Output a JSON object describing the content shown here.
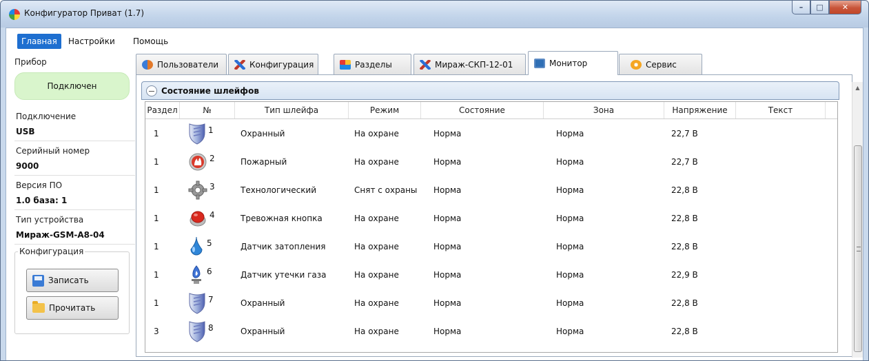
{
  "window": {
    "title": "Конфигуратор Приват (1.7)"
  },
  "menu": {
    "items": [
      "Главная",
      "Настройки",
      "Помощь"
    ]
  },
  "sidebar": {
    "device_group": "Прибор",
    "status": "Подключен",
    "connection_label": "Подключение",
    "connection_value": "USB",
    "serial_label": "Серийный номер",
    "serial_value": "9000",
    "firmware_label": "Версия ПО",
    "firmware_value": "1.0 база: 1",
    "device_type_label": "Тип устройства",
    "device_type_value": "Мираж-GSM-A8-04",
    "config_group": "Конфигурация",
    "write_button": "Записать",
    "read_button": "Прочитать"
  },
  "tabs": [
    "Пользователи",
    "Конфигурация",
    "Разделы",
    "Мираж-СКП-12-01",
    "Монитор",
    "Сервис"
  ],
  "active_tab": "Монитор",
  "section": {
    "title": "Состояние шлейфов"
  },
  "table": {
    "columns": [
      "Раздел",
      "№",
      "Тип шлейфа",
      "Режим",
      "Состояние",
      "Зона",
      "Напряжение",
      "Текст"
    ],
    "rows": [
      {
        "section": "1",
        "num": "1",
        "icon": "shield-icon",
        "type": "Охранный",
        "mode": "На охране",
        "state": "Норма",
        "zone": "Норма",
        "voltage": "22,7 В",
        "text": ""
      },
      {
        "section": "1",
        "num": "2",
        "icon": "fire-icon",
        "type": "Пожарный",
        "mode": "На охране",
        "state": "Норма",
        "zone": "Норма",
        "voltage": "22,7 В",
        "text": ""
      },
      {
        "section": "1",
        "num": "3",
        "icon": "gear-icon",
        "type": "Технологический",
        "mode": "Снят с охраны",
        "state": "Норма",
        "zone": "Норма",
        "voltage": "22,8 В",
        "text": ""
      },
      {
        "section": "1",
        "num": "4",
        "icon": "alarm-button-icon",
        "type": "Тревожная кнопка",
        "mode": "На охране",
        "state": "Норма",
        "zone": "Норма",
        "voltage": "22,8 В",
        "text": ""
      },
      {
        "section": "1",
        "num": "5",
        "icon": "water-drop-icon",
        "type": "Датчик затопления",
        "mode": "На охране",
        "state": "Норма",
        "zone": "Норма",
        "voltage": "22,8 В",
        "text": ""
      },
      {
        "section": "1",
        "num": "6",
        "icon": "gas-burner-icon",
        "type": "Датчик утечки газа",
        "mode": "На охране",
        "state": "Норма",
        "zone": "Норма",
        "voltage": "22,9 В",
        "text": ""
      },
      {
        "section": "1",
        "num": "7",
        "icon": "shield-icon",
        "type": "Охранный",
        "mode": "На охране",
        "state": "Норма",
        "zone": "Норма",
        "voltage": "22,8 В",
        "text": ""
      },
      {
        "section": "3",
        "num": "8",
        "icon": "shield-icon",
        "type": "Охранный",
        "mode": "На охране",
        "state": "Норма",
        "zone": "Норма",
        "voltage": "22,8 В",
        "text": ""
      }
    ]
  },
  "colors": {
    "accent": "#1e6fd0",
    "status_ok": "#d9f5cc",
    "title_bar": "#c2d4ea"
  }
}
